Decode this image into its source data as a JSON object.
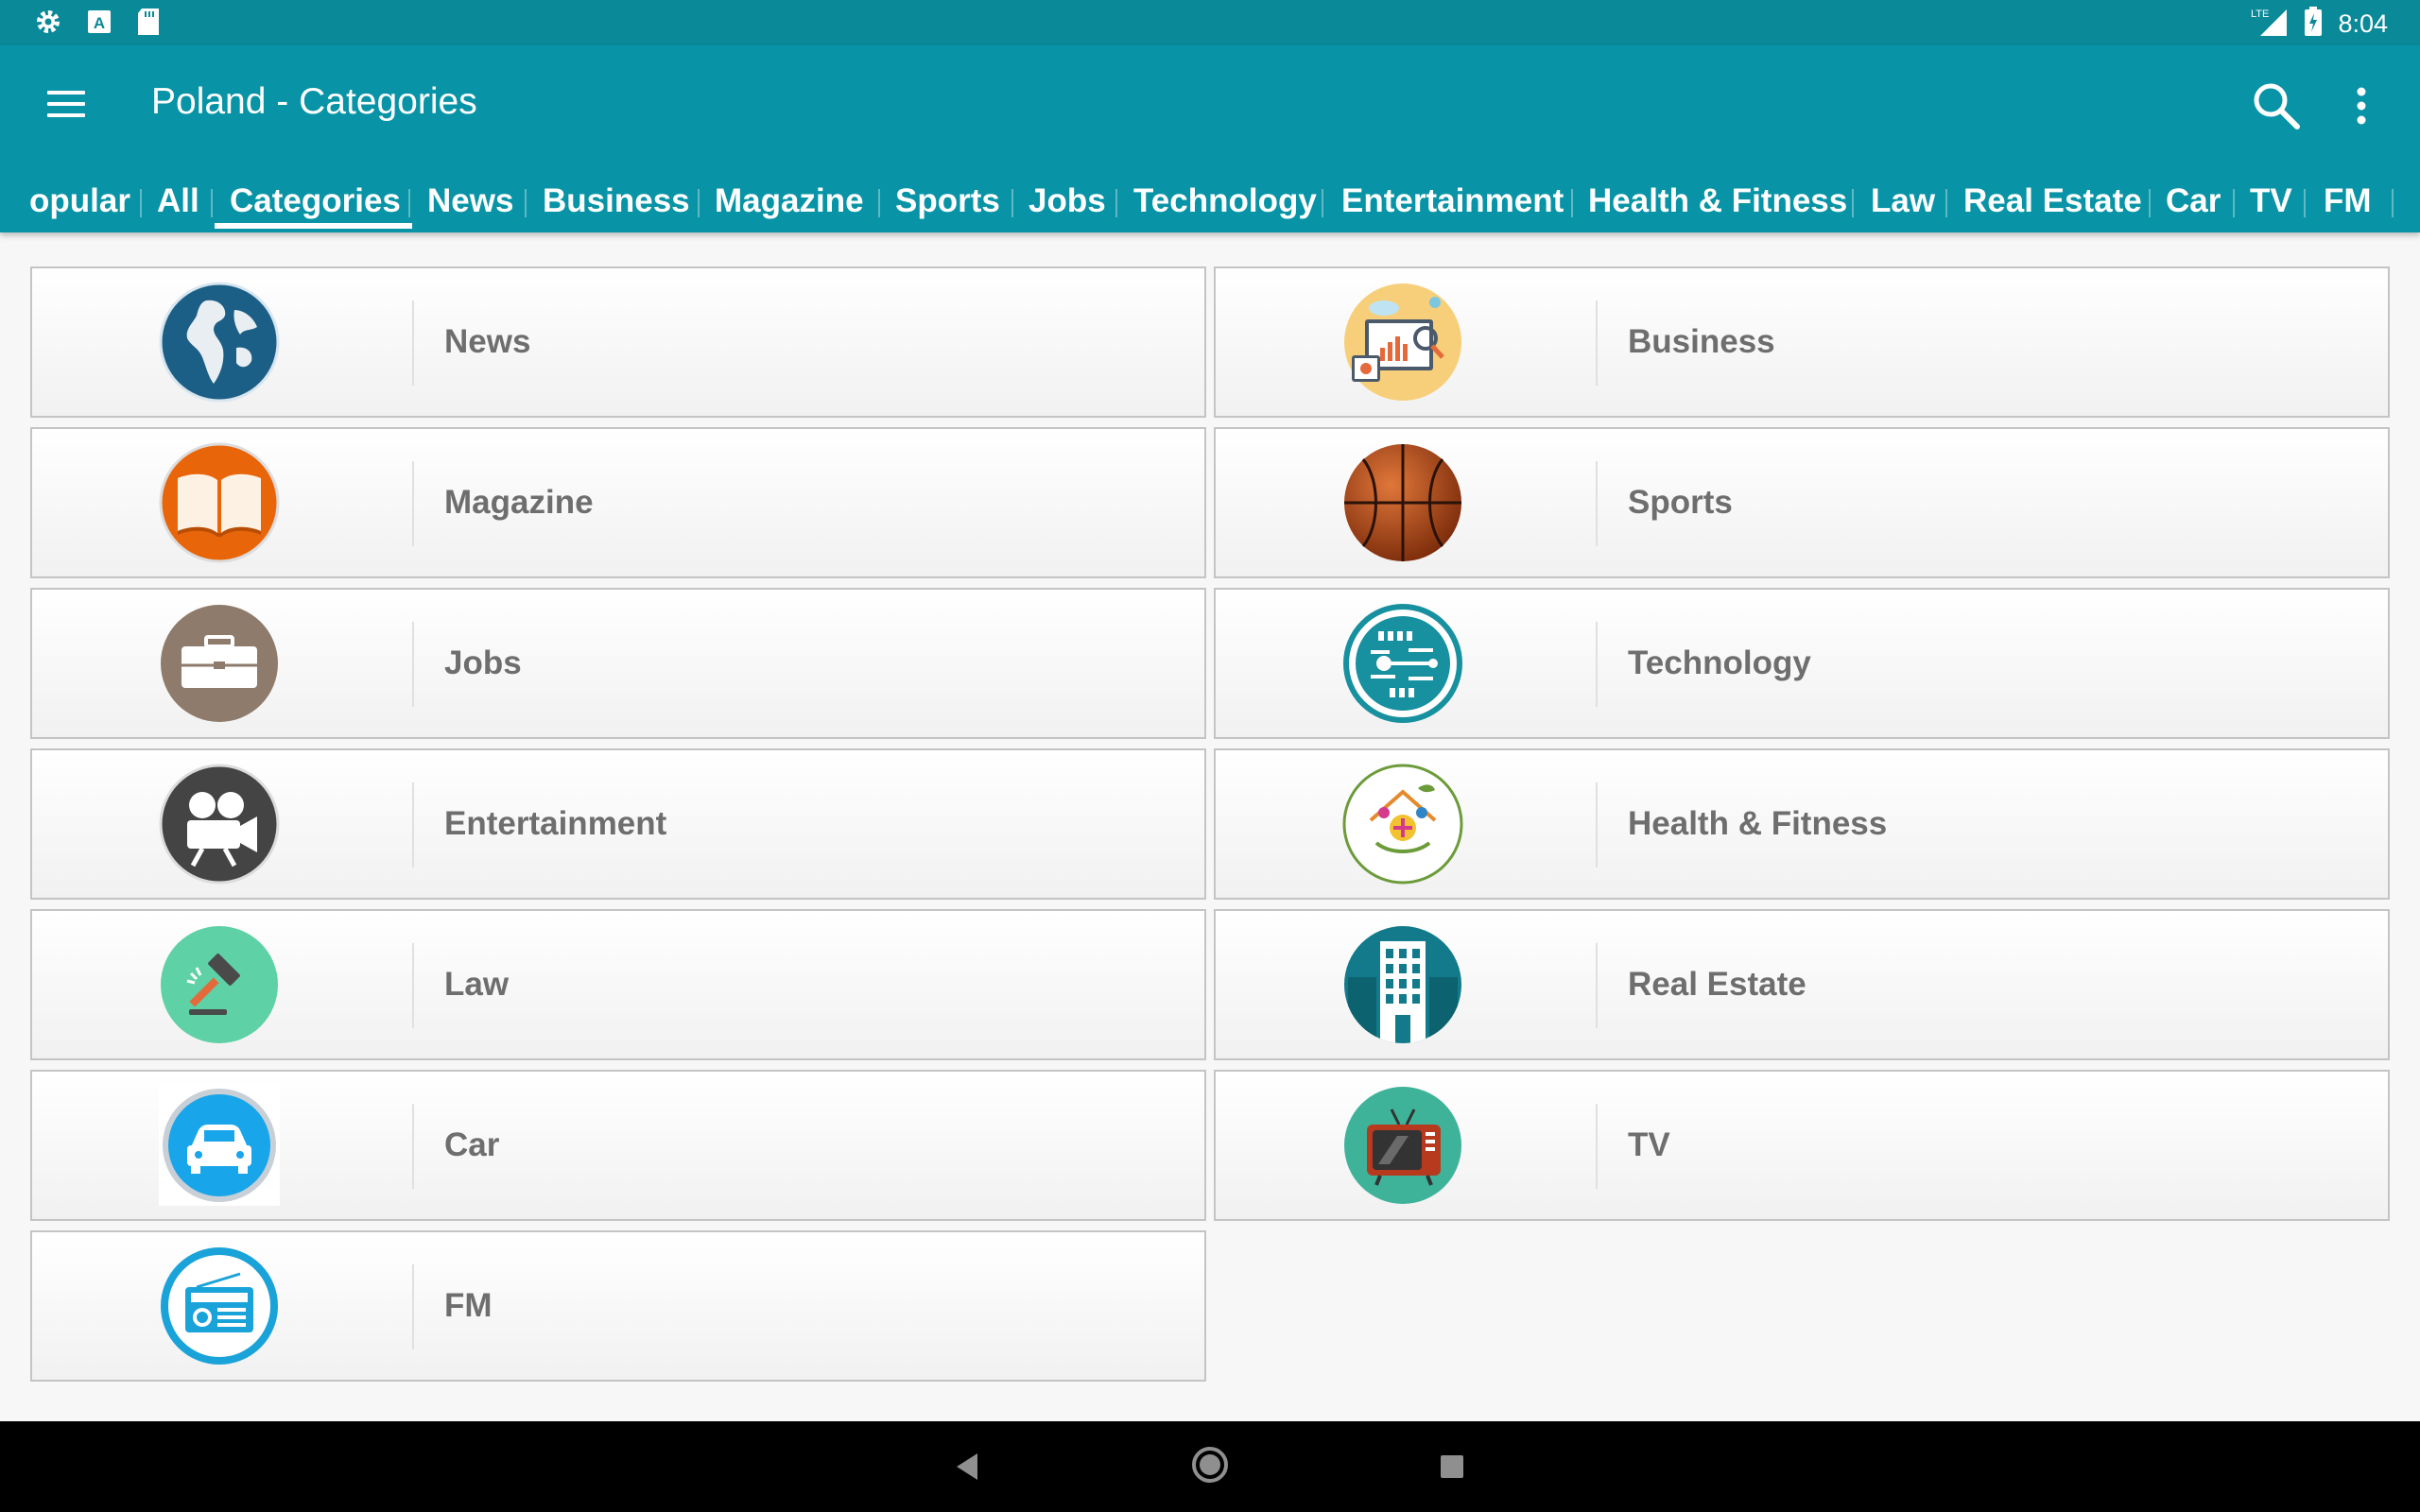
{
  "status_bar": {
    "time": "8:04",
    "icons": [
      "settings-icon",
      "a-letter-icon",
      "sd-card-icon",
      "lte-signal-icon",
      "battery-icon"
    ]
  },
  "app_bar": {
    "title": "Poland - Categories",
    "menu_icon": "hamburger-menu-icon",
    "search_icon": "search-icon",
    "more_icon": "more-vert-icon",
    "color": "#0894a6"
  },
  "tabs": [
    {
      "label": "opular"
    },
    {
      "label": "All"
    },
    {
      "label": "Categories",
      "selected": true
    },
    {
      "label": "News"
    },
    {
      "label": "Business"
    },
    {
      "label": "Magazine"
    },
    {
      "label": "Sports"
    },
    {
      "label": "Jobs"
    },
    {
      "label": "Technology"
    },
    {
      "label": "Entertainment"
    },
    {
      "label": "Health & Fitness"
    },
    {
      "label": "Law"
    },
    {
      "label": "Real Estate"
    },
    {
      "label": "Car"
    },
    {
      "label": "TV"
    },
    {
      "label": "FM"
    }
  ],
  "categories": [
    {
      "label": "News",
      "icon": "globe-icon"
    },
    {
      "label": "Business",
      "icon": "business-chart-icon"
    },
    {
      "label": "Magazine",
      "icon": "book-icon"
    },
    {
      "label": "Sports",
      "icon": "basketball-icon"
    },
    {
      "label": "Jobs",
      "icon": "briefcase-icon"
    },
    {
      "label": "Technology",
      "icon": "circuit-icon"
    },
    {
      "label": "Entertainment",
      "icon": "movie-camera-icon"
    },
    {
      "label": "Health & Fitness",
      "icon": "health-icon"
    },
    {
      "label": "Law",
      "icon": "gavel-icon"
    },
    {
      "label": "Real Estate",
      "icon": "building-icon"
    },
    {
      "label": "Car",
      "icon": "car-icon"
    },
    {
      "label": "TV",
      "icon": "retro-tv-icon"
    },
    {
      "label": "FM",
      "icon": "radio-icon"
    }
  ],
  "nav_bar": {
    "back_icon": "back-triangle-icon",
    "home_icon": "home-circle-icon",
    "recents_icon": "recents-square-icon"
  }
}
